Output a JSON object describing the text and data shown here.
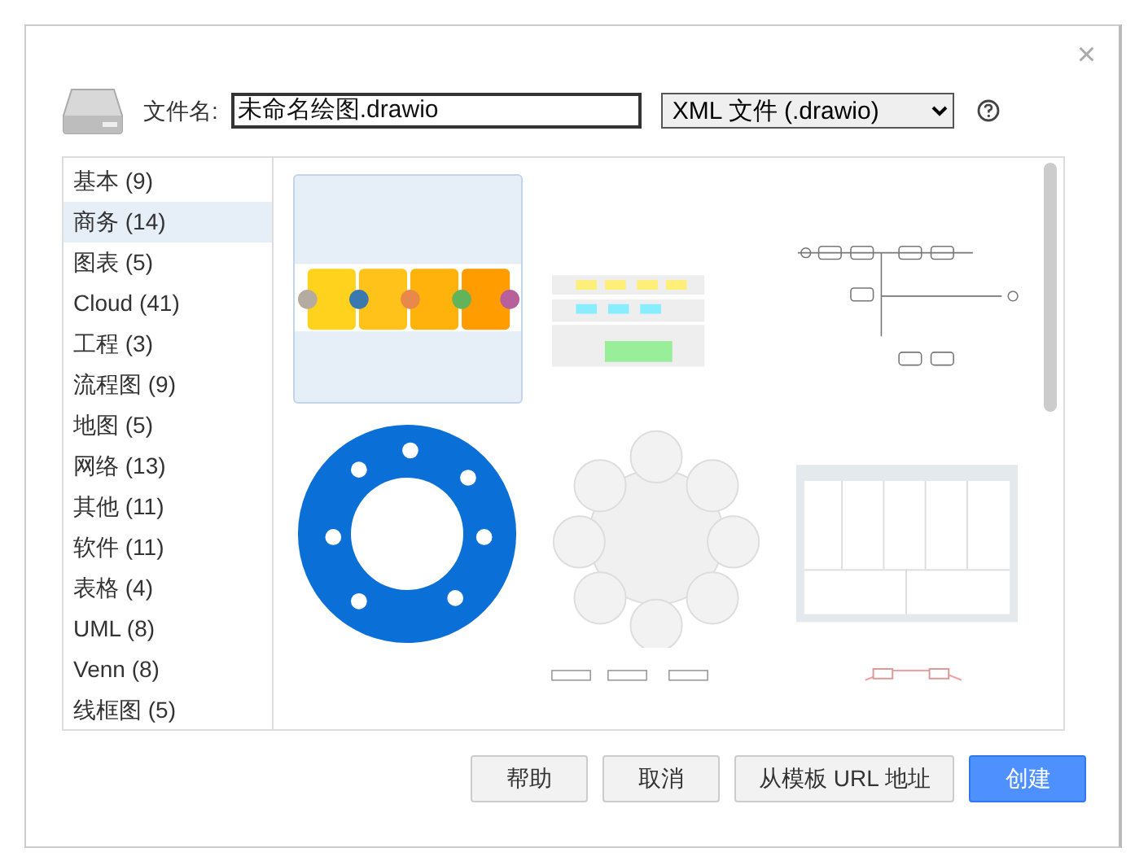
{
  "dialog": {
    "close": "×"
  },
  "file": {
    "label": "文件名:",
    "value": "未命名绘图.drawio",
    "format": "XML 文件 (.drawio)"
  },
  "categories": [
    {
      "label": "基本 (9)",
      "selected": false
    },
    {
      "label": "商务 (14)",
      "selected": true
    },
    {
      "label": "图表 (5)",
      "selected": false
    },
    {
      "label": "Cloud (41)",
      "selected": false
    },
    {
      "label": "工程 (3)",
      "selected": false
    },
    {
      "label": "流程图 (9)",
      "selected": false
    },
    {
      "label": "地图 (5)",
      "selected": false
    },
    {
      "label": "网络 (13)",
      "selected": false
    },
    {
      "label": "其他 (11)",
      "selected": false
    },
    {
      "label": "软件 (11)",
      "selected": false
    },
    {
      "label": "表格 (4)",
      "selected": false
    },
    {
      "label": "UML (8)",
      "selected": false
    },
    {
      "label": "Venn (8)",
      "selected": false
    },
    {
      "label": "线框图 (5)",
      "selected": false
    }
  ],
  "templates": [
    {
      "kind": "picture",
      "selected": true
    },
    {
      "kind": "picture",
      "selected": false
    },
    {
      "kind": "picture",
      "selected": false
    },
    {
      "kind": "picture",
      "selected": false
    },
    {
      "kind": "picture",
      "selected": false
    },
    {
      "kind": "picture",
      "selected": false
    },
    {
      "kind": "blank"
    },
    {
      "kind": "picture",
      "selected": false
    },
    {
      "kind": "picture",
      "selected": false
    }
  ],
  "buttons": [
    {
      "label": "帮助",
      "kind": "default"
    },
    {
      "label": "取消",
      "kind": "default"
    },
    {
      "label": "从模板 URL 地址",
      "kind": "default"
    },
    {
      "label": "创建",
      "kind": "primary"
    }
  ]
}
